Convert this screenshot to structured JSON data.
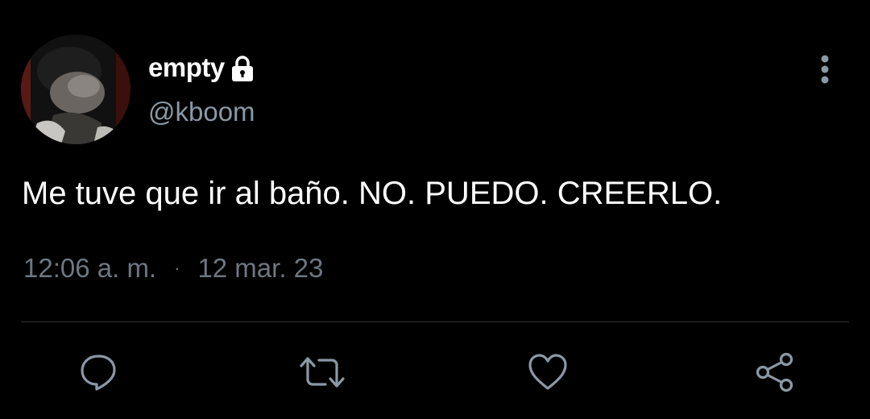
{
  "user": {
    "display_name": "empty",
    "handle": "@kboom",
    "protected_icon": "lock-icon",
    "avatar": "avatar-image"
  },
  "tweet": {
    "text": "Me tuve que ir al baño. NO. PUEDO. CREERLO.",
    "time": "12:06 a. m.",
    "separator": "·",
    "date": "12 mar. 23"
  },
  "actions": {
    "reply_icon": "reply-icon",
    "retweet_icon": "retweet-icon",
    "like_icon": "heart-icon",
    "share_icon": "share-icon",
    "more_icon": "more-vertical-icon"
  },
  "colors": {
    "background": "#000000",
    "primary_text": "#ffffff",
    "secondary_text": "#8b98a5",
    "meta_text": "#6e7781",
    "icon": "#8b98a5",
    "divider": "#2f3336"
  }
}
